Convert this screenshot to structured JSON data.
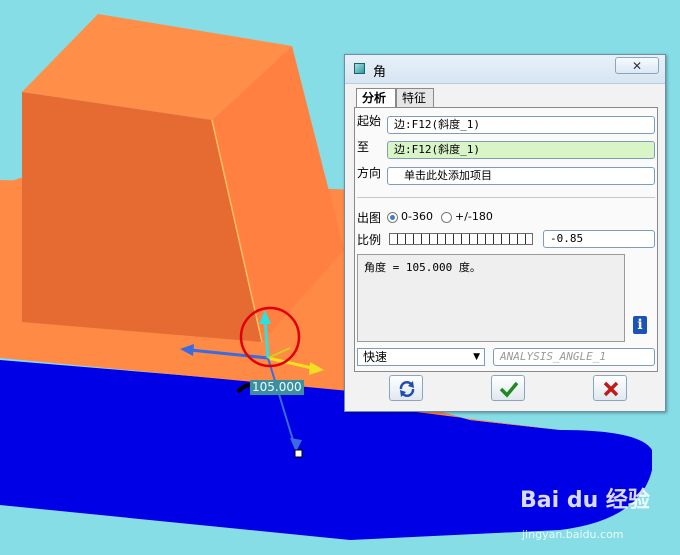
{
  "colors": {
    "background": "#86dde6",
    "orange_top": "#ff8e48",
    "orange_front": "#e76f35",
    "orange_side": "#ff8040",
    "blue_body": "#0000e6",
    "dialog_bg": "#f2f2f2",
    "highlight_circle": "#e00000",
    "accent_green": "#d9f5c8"
  },
  "dialog": {
    "title": "角",
    "close_label": "✕",
    "tabs": [
      {
        "label": "分析",
        "active": true
      },
      {
        "label": "特征",
        "active": false
      }
    ],
    "start": {
      "label": "起始",
      "value": "边:F12(斜度_1)"
    },
    "to": {
      "label": "至",
      "value": "边:F12(斜度_1)"
    },
    "direction": {
      "label": "方向",
      "value": "单击此处添加项目"
    },
    "output": {
      "label": "出图",
      "options": [
        {
          "label": "0-360",
          "selected": true
        },
        {
          "label": "+/-180",
          "selected": false
        }
      ]
    },
    "scale": {
      "label": "比例",
      "value": "-0.85"
    },
    "result_text": "角度 = 105.000 度。",
    "info_icon": "info-icon",
    "mode": {
      "selected": "快速"
    },
    "name_field": {
      "value": "ANALYSIS_ANGLE_1"
    },
    "buttons": {
      "refresh_icon": "refresh-icon",
      "ok_icon": "check-icon",
      "cancel_icon": "close-icon"
    }
  },
  "viewport": {
    "dimension_label": "105.000"
  },
  "watermark": {
    "main": "Bai du 经验",
    "sub": "jingyan.baidu.com"
  }
}
